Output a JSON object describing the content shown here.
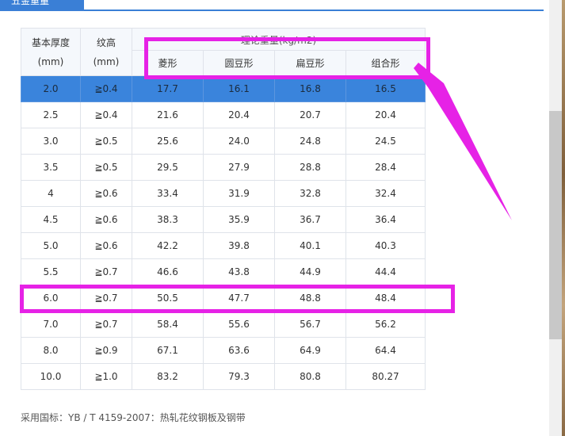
{
  "tab": {
    "label": "五金重量"
  },
  "table": {
    "col_thickness": {
      "line1": "基本厚度",
      "line2": "(mm)"
    },
    "col_ridge": {
      "line1": "纹高",
      "line2": "(mm)"
    },
    "group_header": "理论重量(kg/m2)",
    "sub_headers": [
      "菱形",
      "圆豆形",
      "扁豆形",
      "组合形"
    ],
    "rows": [
      {
        "thickness": "2.0",
        "ridge": "≧0.4",
        "values": [
          "17.7",
          "16.1",
          "16.8",
          "16.5"
        ]
      },
      {
        "thickness": "2.5",
        "ridge": "≧0.4",
        "values": [
          "21.6",
          "20.4",
          "20.7",
          "20.4"
        ]
      },
      {
        "thickness": "3.0",
        "ridge": "≧0.5",
        "values": [
          "25.6",
          "24.0",
          "24.8",
          "24.5"
        ]
      },
      {
        "thickness": "3.5",
        "ridge": "≧0.5",
        "values": [
          "29.5",
          "27.9",
          "28.8",
          "28.4"
        ]
      },
      {
        "thickness": "4",
        "ridge": "≧0.6",
        "values": [
          "33.4",
          "31.9",
          "32.8",
          "32.4"
        ]
      },
      {
        "thickness": "4.5",
        "ridge": "≧0.6",
        "values": [
          "38.3",
          "35.9",
          "36.7",
          "36.4"
        ]
      },
      {
        "thickness": "5.0",
        "ridge": "≧0.6",
        "values": [
          "42.2",
          "39.8",
          "40.1",
          "40.3"
        ]
      },
      {
        "thickness": "5.5",
        "ridge": "≧0.7",
        "values": [
          "46.6",
          "43.8",
          "44.9",
          "44.4"
        ]
      },
      {
        "thickness": "6.0",
        "ridge": "≧0.7",
        "values": [
          "50.5",
          "47.7",
          "48.8",
          "48.4"
        ]
      },
      {
        "thickness": "7.0",
        "ridge": "≧0.7",
        "values": [
          "58.4",
          "55.6",
          "56.7",
          "56.2"
        ]
      },
      {
        "thickness": "8.0",
        "ridge": "≧0.9",
        "values": [
          "67.1",
          "63.6",
          "64.9",
          "64.4"
        ]
      },
      {
        "thickness": "10.0",
        "ridge": "≧1.0",
        "values": [
          "83.2",
          "79.3",
          "80.8",
          "80.27"
        ]
      }
    ]
  },
  "footnote": "采用国标：YB / T 4159-2007：热轧花纹钢板及钢带",
  "colors": {
    "accent": "#3a7fd6",
    "selected_row": "#3a84dc",
    "annotation": "#e622e6"
  }
}
